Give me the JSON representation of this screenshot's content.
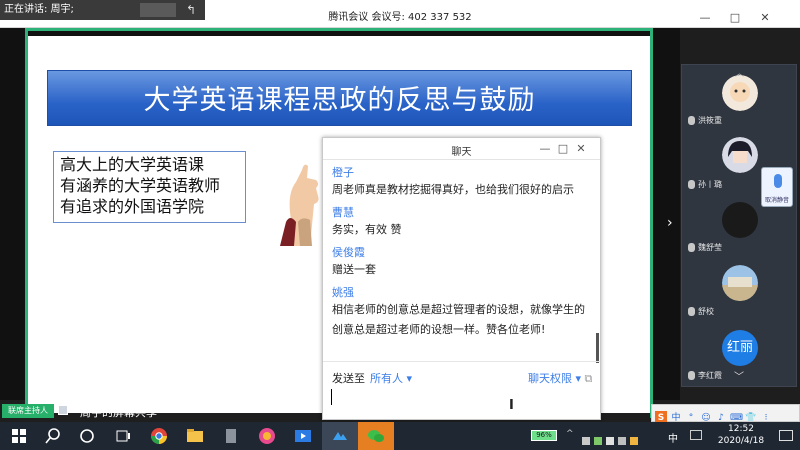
{
  "titlebar": {
    "speaking_label": "正在讲话: 周宇;",
    "meeting_title": "腾讯会议 会议号: 402 337 532",
    "controls": [
      "—",
      "□",
      "✕"
    ]
  },
  "slide": {
    "title": "大学英语课程思政的反思与鼓励",
    "lines": [
      "高大上的大学英语课",
      "有涵养的大学英语教师",
      "有追求的外国语学院"
    ]
  },
  "chat": {
    "title": "聊天",
    "controls": [
      "—",
      "□",
      "✕"
    ],
    "messages": [
      {
        "name": "橙子",
        "text": "周老师真是教材挖掘得真好，也给我们很好的启示"
      },
      {
        "name": "曹慧",
        "text": "务实，有效 赞"
      },
      {
        "name": "侯俊霞",
        "text": "赠送一套"
      },
      {
        "name": "姚强",
        "text": "相信老师的创意总是超过管理者的设想，就像学生的创意总是超过老师的设想一样。赞各位老师!"
      }
    ],
    "send_to_label": "发送至",
    "send_to_value": "所有人",
    "permission_label": "聊天权限",
    "input_value": ""
  },
  "participants": [
    {
      "name": "洪筱重",
      "avatar": "photo"
    },
    {
      "name": "孙丨璐",
      "avatar": "anime"
    },
    {
      "name": "魏舒莹",
      "avatar": "blank"
    },
    {
      "name": "舒校",
      "avatar": "landscape"
    },
    {
      "name": "李红霞",
      "avatar": "红丽"
    }
  ],
  "mic_tool_label": "取消静音",
  "bottom": {
    "host_badge": "联席主持人",
    "share_status": "周宇的屏幕共享"
  },
  "ime": [
    "S",
    "中",
    "°",
    "☺",
    "♪",
    "⌨",
    "👕",
    "⁝"
  ],
  "taskbar": {
    "battery": "96%",
    "tray_text": "中",
    "time": "12:52",
    "date": "2020/4/18"
  },
  "colors": {
    "accent_green": "#2db37a",
    "link_blue": "#3d7ee8",
    "slide_title_blue": "#2a63c8"
  }
}
